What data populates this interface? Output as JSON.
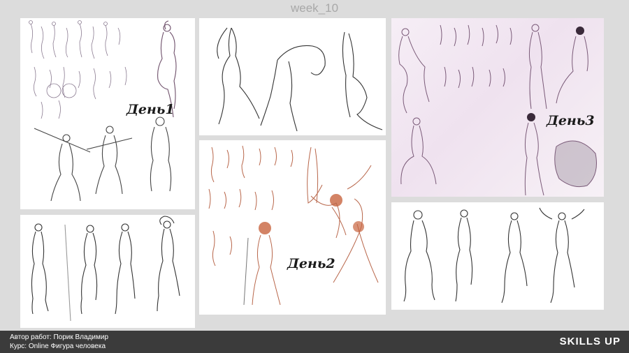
{
  "header": {
    "title": "week_10"
  },
  "panels": {
    "day1_label": "День1",
    "day2_label": "День2",
    "day3_label": "День3"
  },
  "footer": {
    "author_line": "Автор работ: Порик Владимир",
    "course_line": "Курс: Online Фигура человека",
    "brand": "SKILLS UP"
  },
  "colors": {
    "background": "#dcdcdc",
    "footer": "#3b3b3b",
    "sketch_red": "#b8664a",
    "sketch_purple": "#7a5a78"
  }
}
